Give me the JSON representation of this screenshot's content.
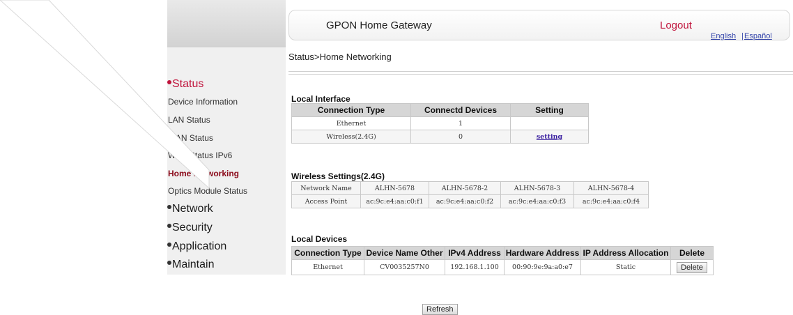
{
  "header": {
    "title": "GPON Home Gateway",
    "logout_label": "Logout",
    "lang_english": "English",
    "lang_separator": "|",
    "lang_spanish": "Español"
  },
  "breadcrumb": "Status>Home Networking",
  "sidebar": {
    "status_label": "Status",
    "status_items": [
      {
        "label": "Device Information",
        "active": false
      },
      {
        "label": "LAN Status",
        "active": false
      },
      {
        "label": "WAN Status",
        "active": false
      },
      {
        "label": "WAN Status IPv6",
        "active": false
      },
      {
        "label": "Home Networking",
        "active": true
      },
      {
        "label": "Optics Module Status",
        "active": false
      }
    ],
    "sections": [
      "Network",
      "Security",
      "Application",
      "Maintain"
    ]
  },
  "local_interface": {
    "title": "Local Interface",
    "headers": [
      "Connection Type",
      "Connectd Devices",
      "Setting"
    ],
    "rows": [
      {
        "type": "Ethernet",
        "devices": "1",
        "setting": ""
      },
      {
        "type": "Wireless(2.4G)",
        "devices": "0",
        "setting": "setting"
      }
    ]
  },
  "wireless": {
    "title": "Wireless Settings(2.4G)",
    "name_label": "Network Name",
    "ap_label": "Access Point",
    "names": [
      "ALHN-5678",
      "ALHN-5678-2",
      "ALHN-5678-3",
      "ALHN-5678-4"
    ],
    "aps": [
      "ac:9c:e4:aa:c0:f1",
      "ac:9c:e4:aa:c0:f2",
      "ac:9c:e4:aa:c0:f3",
      "ac:9c:e4:aa:c0:f4"
    ]
  },
  "local_devices": {
    "title": "Local Devices",
    "headers": [
      "Connection Type",
      "Device Name Other",
      "IPv4 Address",
      "Hardware Address",
      "IP Address Allocation",
      "Delete"
    ],
    "rows": [
      {
        "type": "Ethernet",
        "name": "CV0035257N0",
        "ipv4": "192.168.1.100",
        "mac": "00:90:9e:9a:a0:e7",
        "allocation": "Static",
        "delete_label": "Delete"
      }
    ]
  },
  "refresh_label": "Refresh",
  "colors": {
    "accent_red": "#c0143c",
    "active_nav": "#8b0a1a",
    "link_purple": "#3a1fa0"
  }
}
